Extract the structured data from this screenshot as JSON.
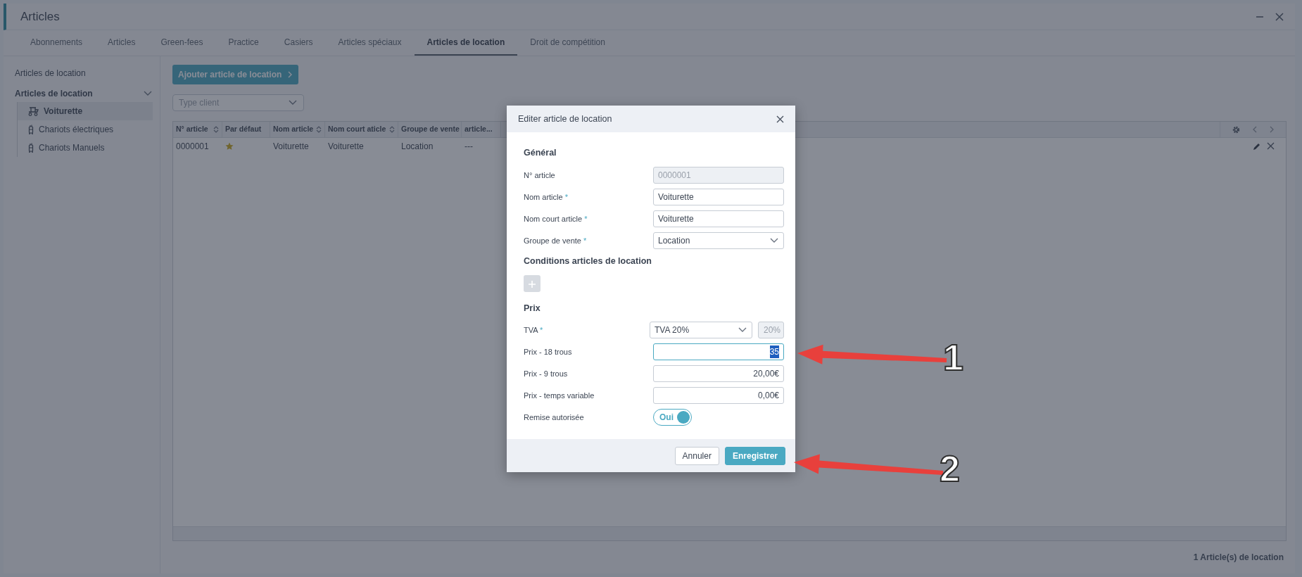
{
  "window": {
    "title": "Articles"
  },
  "tabs": [
    {
      "label": "Abonnements",
      "selected": false
    },
    {
      "label": "Articles",
      "selected": false
    },
    {
      "label": "Green-fees",
      "selected": false
    },
    {
      "label": "Practice",
      "selected": false
    },
    {
      "label": "Casiers",
      "selected": false
    },
    {
      "label": "Articles spéciaux",
      "selected": false
    },
    {
      "label": "Articles de location",
      "selected": true
    },
    {
      "label": "Droit de compétition",
      "selected": false
    }
  ],
  "sidebar": {
    "heading": "Articles de location",
    "group": {
      "label": "Articles de location",
      "expanded": true,
      "children": [
        {
          "label": "Voiturette",
          "kind": "cart",
          "selected": true
        },
        {
          "label": "Chariots électriques",
          "kind": "trolley",
          "selected": false
        },
        {
          "label": "Chariots Manuels",
          "kind": "trolley",
          "selected": false
        }
      ]
    }
  },
  "add_button": "Ajouter article de location",
  "filter": {
    "placeholder": "Type client"
  },
  "table": {
    "columns": [
      {
        "label": "N° article",
        "sortable": true
      },
      {
        "label": "Par défaut",
        "sortable": false
      },
      {
        "label": "Nom article",
        "sortable": true
      },
      {
        "label": "Nom court aticle",
        "sortable": true
      },
      {
        "label": "Groupe de vente",
        "sortable": false
      },
      {
        "label": "article...",
        "sortable": false
      }
    ],
    "rows": [
      {
        "cells": [
          "0000001",
          null,
          "Voiturette",
          "Voiturette",
          "Location",
          "---"
        ],
        "default": true
      }
    ]
  },
  "footer_count": "1 Article(s) de location",
  "dialog": {
    "title": "Editer article de location",
    "sections": [
      {
        "title": "Général",
        "fields": [
          {
            "kind": "text",
            "label": "N° article",
            "required": false,
            "value": "0000001",
            "disabled": true
          },
          {
            "kind": "text",
            "label": "Nom article",
            "required": true,
            "value": "Voiturette",
            "disabled": false
          },
          {
            "kind": "text",
            "label": "Nom court article",
            "required": true,
            "value": "Voiturette",
            "disabled": false
          },
          {
            "kind": "select",
            "label": "Groupe de vente",
            "required": true,
            "value": "Location"
          }
        ]
      },
      {
        "title": "Conditions articles de location",
        "fields": [
          {
            "kind": "add"
          }
        ]
      },
      {
        "title": "Prix",
        "fields": [
          {
            "kind": "rate",
            "label": "TVA",
            "required": true,
            "value": "TVA 20%",
            "rate": "20%"
          },
          {
            "kind": "amount",
            "label": "Prix - 18 trous",
            "required": false,
            "value": "35",
            "focused": true,
            "text_selected": true
          },
          {
            "kind": "amount",
            "label": "Prix - 9 trous",
            "required": false,
            "value": "20,00€",
            "focused": false,
            "text_selected": false
          },
          {
            "kind": "amount",
            "label": "Prix - temps variable",
            "required": false,
            "value": "0,00€",
            "focused": false,
            "text_selected": false
          },
          {
            "kind": "toggle",
            "label": "Remise autorisée",
            "on": true,
            "value": "Oui"
          }
        ]
      }
    ],
    "required_mark": "*",
    "buttons": [
      {
        "label": "Annuler",
        "primary": false
      },
      {
        "label": "Enregistrer",
        "primary": true
      }
    ]
  },
  "annotations": [
    {
      "label": "1"
    },
    {
      "label": "2"
    }
  ]
}
